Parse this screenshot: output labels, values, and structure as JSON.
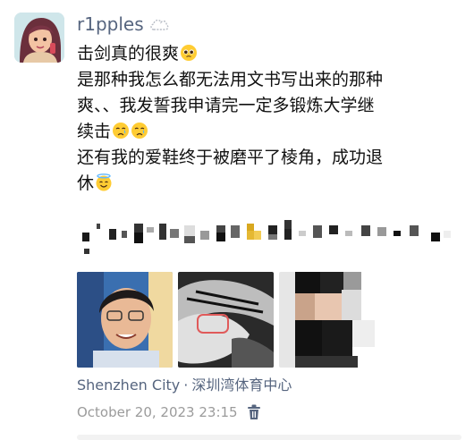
{
  "user": {
    "name": "r1pples",
    "status_icon": "cloud-status-icon",
    "avatar_icon": "cartoon-avatar"
  },
  "post": {
    "lines": [
      "击剑真的很爽",
      "是那种我怎么都无法用文书写出来的那种",
      "爽、、我发誓我申请完一定多锻炼大学继",
      "续击",
      "还有我的爱鞋终于被磨平了棱角，成功退",
      "休"
    ],
    "emojis": [
      "pleading-face",
      "crying-face",
      "crying-face",
      "smiling-face-with-halo"
    ]
  },
  "photos": [
    {
      "name": "photo-selfie"
    },
    {
      "name": "photo-worn-shoe"
    },
    {
      "name": "photo-blurred-person"
    }
  ],
  "location": {
    "city": "Shenzhen City",
    "separator": "·",
    "venue": "深圳湾体育中心"
  },
  "timestamp": "October 20, 2023 23:15",
  "colors": {
    "link": "#56657f",
    "meta": "#9b9b9b",
    "text": "#111111"
  }
}
